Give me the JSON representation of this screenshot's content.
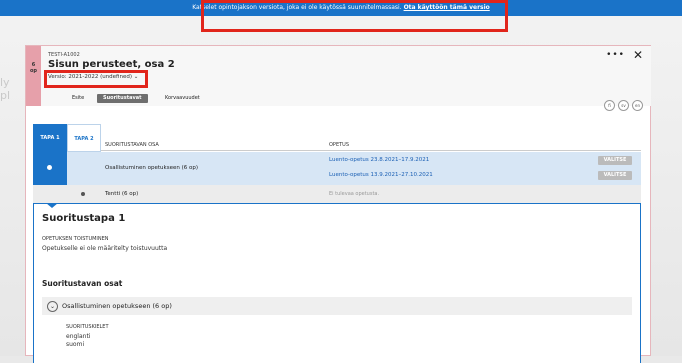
{
  "banner": {
    "text": "Katselet opintojakson versiota, joka ei ole käytössä suunnitelmassasi.",
    "link": "Ota käyttöön tämä versio"
  },
  "background": {
    "partial_text": "ly pl"
  },
  "course": {
    "credits_value": "6",
    "credits_unit": "op",
    "code": "TESTI-A1002",
    "title": "Sisun perusteet, osa 2",
    "version": "Versio: 2021-2022 (undefined)",
    "more_label": "•••",
    "close_label": "✕"
  },
  "tabs": [
    {
      "label": "Esite"
    },
    {
      "label": "Suoritustavat"
    },
    {
      "label": "Korvaavuudet"
    }
  ],
  "lang_buttons": [
    "fi",
    "sv",
    "en"
  ],
  "methods": {
    "tapa1": "TAPA 1",
    "tapa2": "TAPA 2",
    "col_part": "SUORITUSTAVAN OSA",
    "col_teaching": "OPETUS",
    "rows": [
      {
        "part": "Osallistuminen opetukseen (6 op)",
        "teaching": [
          "Luento-opetus 23.8.2021–17.9.2021",
          "Luento-opetus 13.9.2021–27.10.2021"
        ],
        "button": "VALITSE"
      },
      {
        "part": "Tentti (6 op)",
        "teaching_none": "Ei tulevaa opetusta."
      }
    ]
  },
  "panel": {
    "title": "Suoritustapa 1",
    "repeat_label": "OPETUKSEN TOISTUMINEN",
    "repeat_text": "Opetukselle ei ole määritelty toistuvuutta",
    "parts_title": "Suoritustavan osat",
    "accordion_label": "Osallistuminen opetukseen (6 op)",
    "languages_label": "SUORITUSKIELET",
    "languages": [
      "englanti",
      "suomi"
    ]
  },
  "colors": {
    "banner_blue": "#1a73c8",
    "highlight_red": "#e1251b",
    "credit_pink": "#e6a0aa",
    "row_selected": "#d7e6f5"
  }
}
